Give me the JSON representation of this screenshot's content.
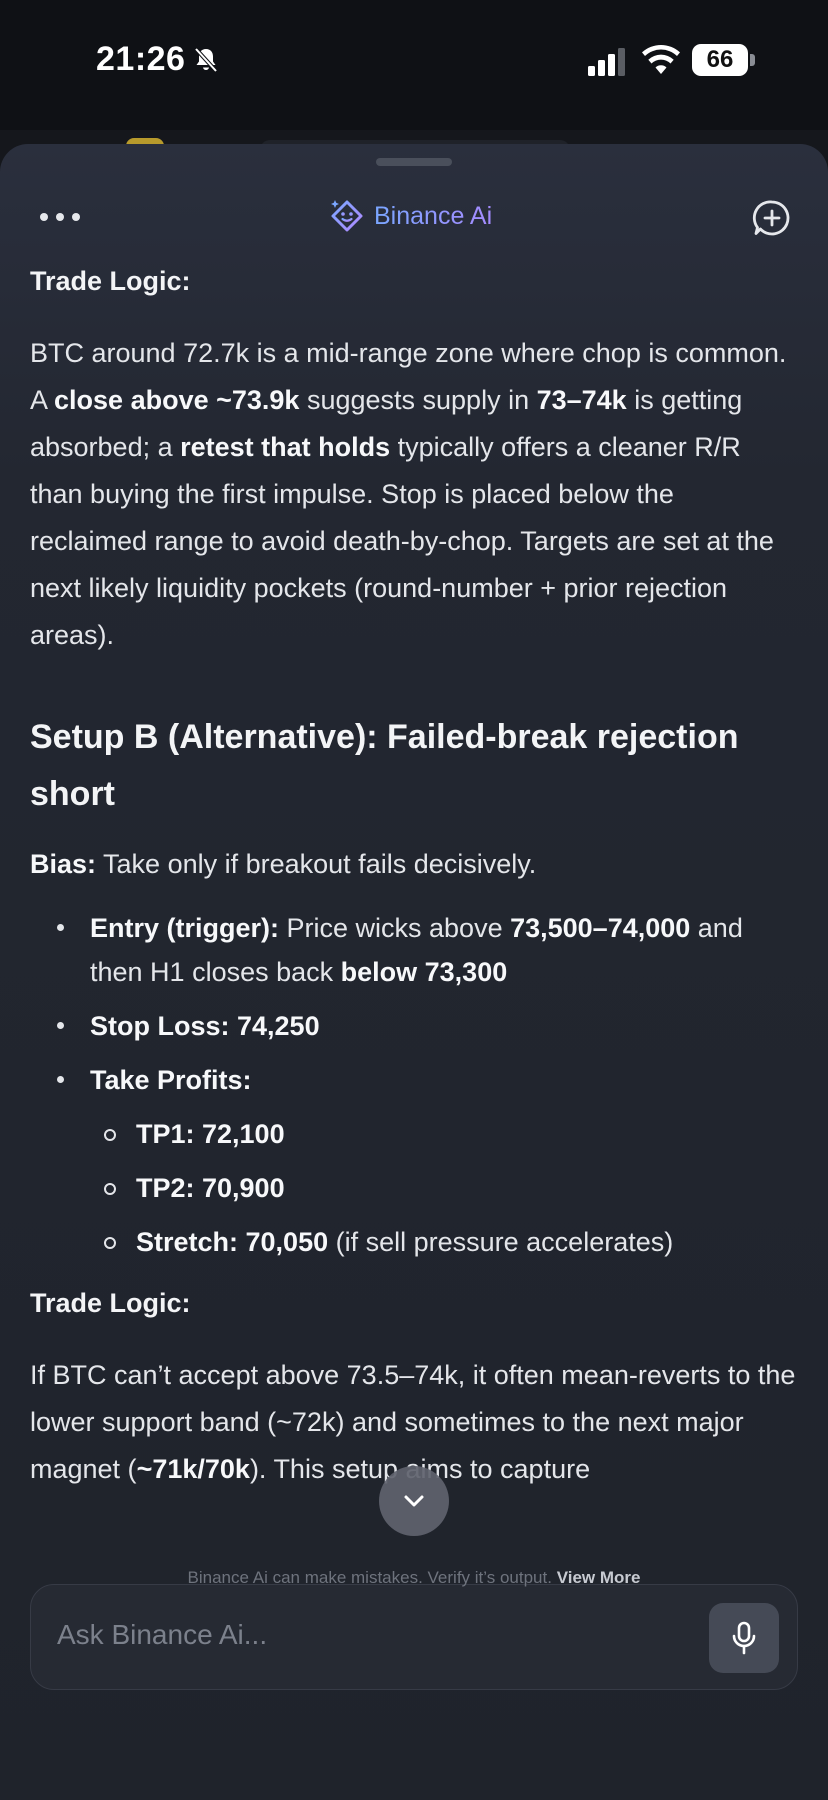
{
  "status_bar": {
    "time": "21:26",
    "battery": "66"
  },
  "header": {
    "brand_name": "Binance Ai"
  },
  "content": {
    "trade_logic_1_label": "Trade Logic:",
    "trade_logic_1": {
      "t1": "BTC around 72.7k is a mid-range zone where chop is common. A ",
      "b1": "close above ~73.9k",
      "t2": " suggests supply in ",
      "b2": "73–74k",
      "t3": " is getting absorbed; a ",
      "b3": "retest that holds",
      "t4": " typically offers a cleaner R/R than buying the first impulse. Stop is placed below the reclaimed range to avoid death-by-chop. Targets are set at the next likely liquidity pockets (round-number + prior rejection areas)."
    },
    "setup_b_title": "Setup B (Alternative): Failed-break rejection short",
    "bias": {
      "label": "Bias:",
      "text": " Take only if breakout fails decisively."
    },
    "entry": {
      "label": "Entry (trigger):",
      "t1": " Price wicks above ",
      "b1": "73,500–74,000",
      "t2": " and then H1 closes back ",
      "b2": "below 73,300"
    },
    "stop_loss": "Stop Loss: 74,250",
    "take_profits_label": "Take Profits:",
    "tp1": "TP1: 72,100",
    "tp2": "TP2: 70,900",
    "stretch": {
      "label": "Stretch: 70,050",
      "text": " (if sell pressure accelerates)"
    },
    "trade_logic_2_label": "Trade Logic:",
    "trade_logic_2": {
      "t1": "If BTC can’t accept above 73.5–74k, it often mean-reverts to the lower support band ",
      "hidden": "(~72k)",
      "t2": " and sometimes to the next major magnet (",
      "b1": "~71k/70k",
      "t3": "). This setup aims to capture"
    }
  },
  "input": {
    "placeholder": "Ask Binance Ai..."
  },
  "footer": {
    "disclaimer": "Binance Ai can make mistakes. Verify it’s output.",
    "view_more": "View More"
  }
}
